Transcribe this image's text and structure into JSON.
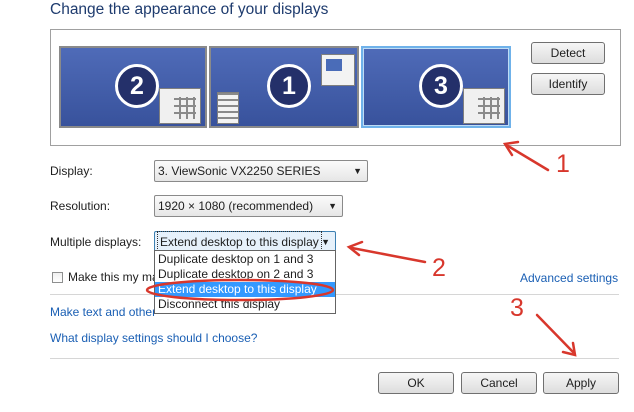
{
  "page_title": "Change the appearance of your displays",
  "monitors": [
    {
      "number": "2",
      "selected": false
    },
    {
      "number": "1",
      "selected": false
    },
    {
      "number": "3",
      "selected": true
    }
  ],
  "buttons": {
    "detect": "Detect",
    "identify": "Identify",
    "ok": "OK",
    "cancel": "Cancel",
    "apply": "Apply"
  },
  "display": {
    "label": "Display:",
    "value": "3. ViewSonic VX2250 SERIES"
  },
  "resolution": {
    "label": "Resolution:",
    "value": "1920 × 1080 (recommended)"
  },
  "multiple_displays": {
    "label": "Multiple displays:",
    "value": "Extend desktop to this display",
    "options": [
      "Duplicate desktop on 1 and 3",
      "Duplicate desktop on 2 and 3",
      "Extend desktop to this display",
      "Disconnect this display"
    ],
    "selected_index": 2
  },
  "main_display_checkbox": {
    "label": "Make this my ma",
    "checked": false
  },
  "links": {
    "advanced_settings": "Advanced settings",
    "make_text_partial": "Make text and other",
    "what_display_settings": "What display settings should I choose?"
  },
  "annotations": [
    "1",
    "2",
    "3"
  ],
  "colors": {
    "link": "#1a5fb4",
    "title": "#1e3b6e",
    "highlight": "#3399ff",
    "annotation": "#d8372c",
    "monitor_blue": "#4462b0"
  }
}
